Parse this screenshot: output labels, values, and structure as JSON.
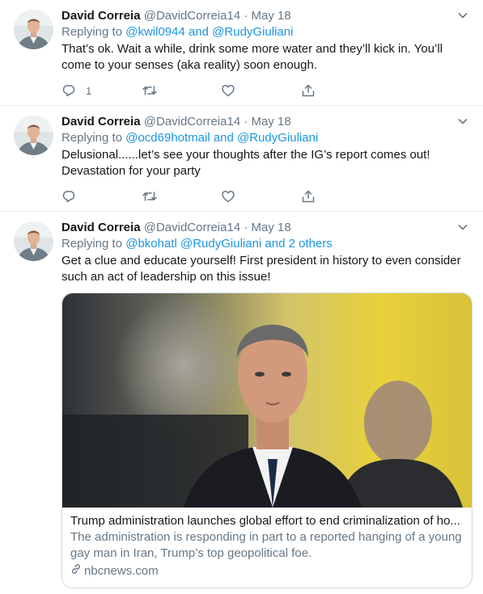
{
  "tweets": [
    {
      "name": "David Correia",
      "handle": "@DavidCorreia14",
      "separator": "·",
      "date": "May 18",
      "replying_prefix": "Replying to",
      "replying_to": "@kwil0944 and @RudyGiuliani",
      "text": "That’s ok. Wait a while, drink some more water and they’ll kick in. You’ll come to your senses (aka reality) soon enough.",
      "reply_count": "1"
    },
    {
      "name": "David Correia",
      "handle": "@DavidCorreia14",
      "separator": "·",
      "date": "May 18",
      "replying_prefix": "Replying to",
      "replying_to": "@ocd69hotmail and @RudyGiuliani",
      "text": "Delusional......let’s see your thoughts after the IG’s report comes out! Devastation for your party",
      "reply_count": ""
    },
    {
      "name": "David Correia",
      "handle": "@DavidCorreia14",
      "separator": "·",
      "date": "May 18",
      "replying_prefix": "Replying to",
      "replying_to": "@bkohatl @RudyGiuliani and 2 others",
      "text": "Get a clue and educate yourself! First president in history to even consider such an act of leadership on this issue!",
      "reply_count": "",
      "card": {
        "title": "Trump administration launches global effort to end criminalization of ho...",
        "description": "The administration is responding in part to a reported hanging of a young gay man in Iran, Trump’s top geopolitical foe.",
        "domain": "nbcnews.com"
      }
    }
  ],
  "icons": [
    "chevron-down-icon",
    "reply-icon",
    "retweet-icon",
    "like-icon",
    "share-icon",
    "link-icon"
  ],
  "colors": {
    "link": "#1b95e0",
    "secondary": "#657786",
    "text": "#14171a",
    "divider": "#e6ecf0",
    "card_border": "#ccd6dd"
  }
}
